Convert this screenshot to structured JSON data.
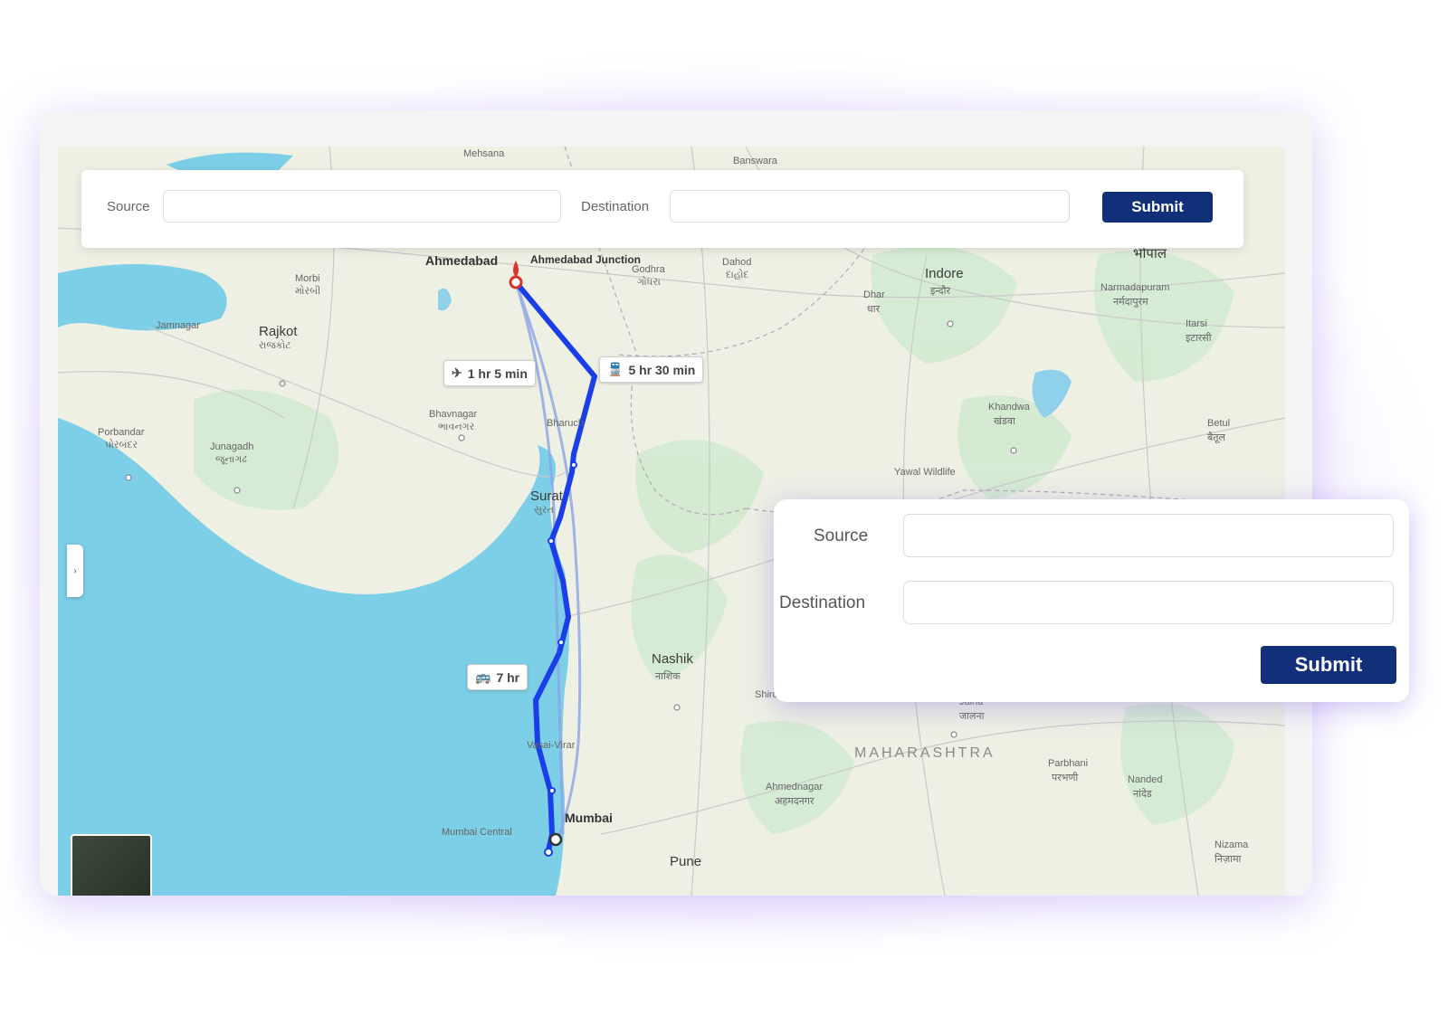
{
  "top_form": {
    "source_label": "Source",
    "destination_label": "Destination",
    "submit_label": "Submit",
    "source_value": "",
    "destination_value": ""
  },
  "overlay_form": {
    "source_label": "Source",
    "destination_label": "Destination",
    "submit_label": "Submit",
    "source_value": "",
    "destination_value": ""
  },
  "map": {
    "routes": {
      "flight": "1 hr 5 min",
      "train": "5 hr 30 min",
      "bus": "7 hr"
    },
    "places": {
      "ahmedabad": "Ahmedabad",
      "ahmedabad_junction": "Ahmedabad Junction",
      "mumbai": "Mumbai",
      "mumbai_central": "Mumbai Central",
      "rajkot": "Rajkot",
      "rajkot_local": "રાજકોટ",
      "indore": "Indore",
      "indore_local": "इन्दौर",
      "nashik": "Nashik",
      "nashik_local": "नाशिक",
      "pune": "Pune",
      "surat": "Surat",
      "surat_local": "સુરત",
      "bharuch": "Bharuch",
      "bhavnagar": "Bhavnagar",
      "bhavnagar_local": "ભાવનગર",
      "jamnagar": "Jamnagar",
      "junagadh": "Junagadh",
      "junagadh_local": "જૂનાગઢ",
      "porbandar": "Porbandar",
      "porbandar_local": "પોરબંદર",
      "morbi": "Morbi",
      "morbi_local": "મોરબી",
      "mehsana": "Mehsana",
      "banswara": "Banswara",
      "godhra": "Godhra",
      "godhra_local": "ગોધરા",
      "dahod": "Dahod",
      "dahod_local": "દાહોદ",
      "dhar": "Dhar",
      "dhar_local": "धार",
      "bhopal_local": "भोपाल",
      "narmadapuram": "Narmadapuram",
      "narmadapuram_local": "नर्मदापुरम",
      "itarsi": "Itarsi",
      "itarsi_local": "इटारसी",
      "khandwa": "Khandwa",
      "khandwa_local": "खंडवा",
      "betul": "Betul",
      "betul_local": "बैतूल",
      "yawal": "Yawal Wildlife",
      "jalna": "Jalna",
      "jalna_local": "जालना",
      "ahmednagar": "Ahmednagar",
      "ahmednagar_local": "अहमदनगर",
      "parbhani": "Parbhani",
      "parbhani_local": "परभणी",
      "nanded": "Nanded",
      "nanded_local": "नांदेड",
      "nizamabad": "Nizama",
      "nizamabad_local": "निज़ामा",
      "shirdi": "Shirdi",
      "maharashtra": "MAHARASHTRA",
      "vasai": "Vasai-Virar"
    }
  },
  "colors": {
    "route": "#1a3ee8",
    "route_alt": "#8aa4e6",
    "button": "#12307a",
    "sea": "#7ccfe6",
    "land": "#eef0e4",
    "forest": "#cfe9cf"
  }
}
